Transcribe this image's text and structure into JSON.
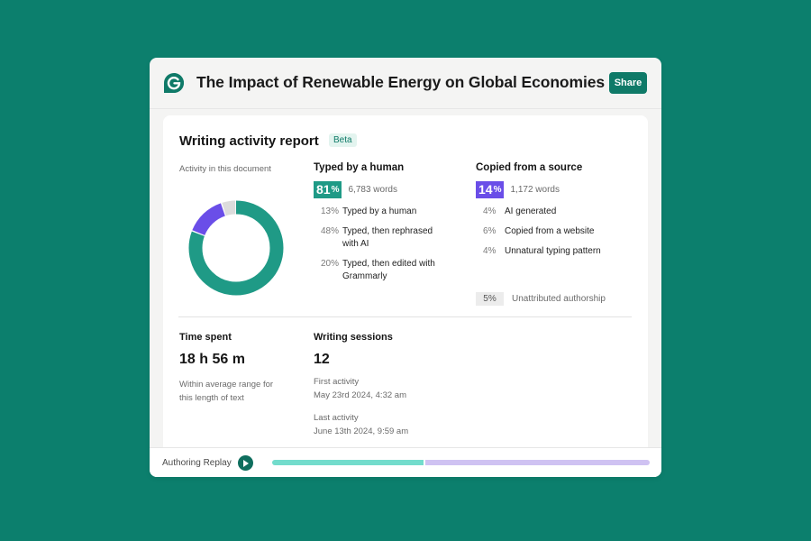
{
  "document": {
    "title": "The Impact of Renewable Energy on Global Economies",
    "logo_icon": "grammarly-g-icon",
    "share_label": "Share"
  },
  "report": {
    "title": "Writing activity report",
    "badge": "Beta",
    "activity_label": "Activity in this document",
    "donut": {
      "segments": [
        {
          "name": "Typed by a human",
          "percent": 81,
          "color": "#1f9a86"
        },
        {
          "name": "Copied from a source",
          "percent": 14,
          "color": "#6a4ee8"
        },
        {
          "name": "Unattributed authorship",
          "percent": 5,
          "color": "#dcdcdc"
        }
      ]
    },
    "typed": {
      "title": "Typed by a human",
      "percent": "81",
      "percent_symbol": "%",
      "words": "6,783 words",
      "color": "#1f9a86",
      "rows": [
        {
          "percent": "13%",
          "label": "Typed by a human"
        },
        {
          "percent": "48%",
          "label": "Typed, then rephrased with AI"
        },
        {
          "percent": "20%",
          "label": "Typed, then edited with Grammarly"
        }
      ]
    },
    "copied": {
      "title": "Copied from a source",
      "percent": "14",
      "percent_symbol": "%",
      "words": "1,172 words",
      "color": "#6a4ee8",
      "rows": [
        {
          "percent": "4%",
          "label": "AI generated"
        },
        {
          "percent": "6%",
          "label": "Copied from a website"
        },
        {
          "percent": "4%",
          "label": "Unnatural typing pattern"
        }
      ]
    },
    "unattributed": {
      "percent": "5%",
      "label": "Unattributed authorship"
    },
    "time_spent": {
      "title": "Time spent",
      "value": "18 h 56 m",
      "note": "Within average range for this length of text"
    },
    "sessions": {
      "title": "Writing sessions",
      "value": "12",
      "first_label": "First activity",
      "first_date": "May 23rd 2024, 4:32 am",
      "last_label": "Last activity",
      "last_date": "June 13th 2024, 9:59 am"
    }
  },
  "replay": {
    "label": "Authoring Replay",
    "play_icon": "play-icon",
    "progress_percent": 40,
    "played_color": "#73dccc",
    "remaining_color": "#cfc2f2"
  }
}
